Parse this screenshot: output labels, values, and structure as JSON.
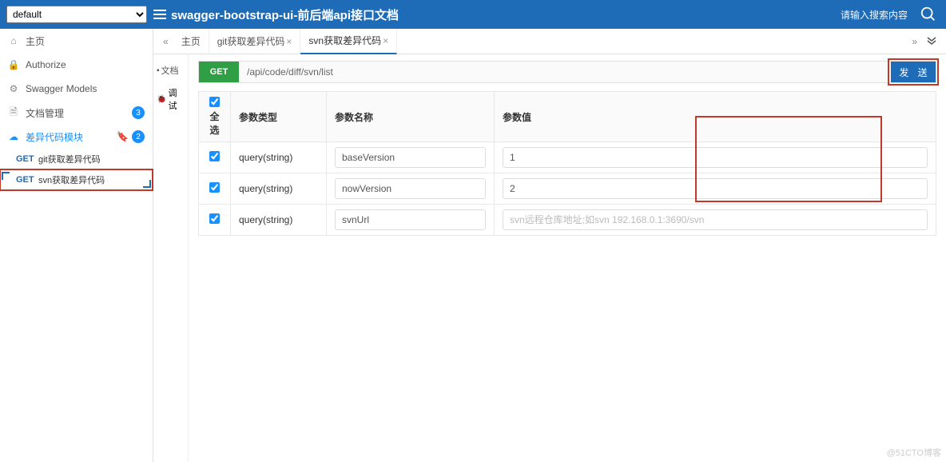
{
  "header": {
    "group_selected": "default",
    "title": "swagger-bootstrap-ui-前后端api接口文档",
    "search_placeholder": "请输入搜索内容"
  },
  "sidebar": {
    "items": [
      {
        "icon": "home",
        "label": "主页"
      },
      {
        "icon": "lock",
        "label": "Authorize"
      },
      {
        "icon": "gear",
        "label": "Swagger Models"
      },
      {
        "icon": "doc",
        "label": "文档管理",
        "badge": "3"
      },
      {
        "icon": "cloud",
        "label": "差异代码模块",
        "badge": "2",
        "tag": true,
        "active": true
      }
    ],
    "subs": [
      {
        "method": "GET",
        "label": "git获取差异代码"
      },
      {
        "method": "GET",
        "label": "svn获取差异代码",
        "selected": true
      }
    ]
  },
  "tabs": {
    "nav_prev": "«",
    "nav_next": "»",
    "nav_more": "⇓",
    "items": [
      {
        "label": "主页",
        "closable": false
      },
      {
        "label": "git获取差异代码",
        "closable": true
      },
      {
        "label": "svn获取差异代码",
        "closable": true,
        "active": true
      }
    ],
    "left": [
      {
        "icon": "📄",
        "label": "文档"
      },
      {
        "icon": "🔍",
        "label": "调试",
        "active": true
      }
    ]
  },
  "api": {
    "method": "GET",
    "url": "/api/code/diff/svn/list",
    "send": "发 送"
  },
  "table": {
    "select_all": "全选",
    "headers": {
      "type": "参数类型",
      "name": "参数名称",
      "value": "参数值"
    },
    "rows": [
      {
        "checked": true,
        "type": "query(string)",
        "name": "baseVersion",
        "value": "1"
      },
      {
        "checked": true,
        "type": "query(string)",
        "name": "nowVersion",
        "value": "2"
      },
      {
        "checked": true,
        "type": "query(string)",
        "name": "svnUrl",
        "value": "",
        "placeholder": "svn远程仓库地址;如svn 192.168.0.1:3690/svn"
      }
    ]
  },
  "watermark": "@51CTO博客"
}
